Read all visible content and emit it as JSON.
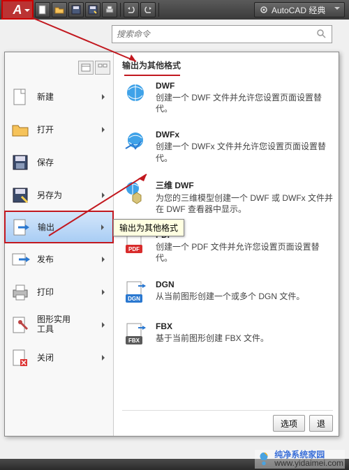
{
  "workspace": {
    "label": "AutoCAD 经典"
  },
  "search": {
    "placeholder": "搜索命令"
  },
  "left_menu": {
    "items": [
      {
        "label": "新建"
      },
      {
        "label": "打开"
      },
      {
        "label": "保存"
      },
      {
        "label": "另存为"
      },
      {
        "label": "输出"
      },
      {
        "label": "发布"
      },
      {
        "label": "打印"
      },
      {
        "label": "图形实用\n工具"
      },
      {
        "label": "关闭"
      }
    ]
  },
  "panel": {
    "title": "输出为其他格式",
    "options": [
      {
        "title": "DWF",
        "desc": "创建一个 DWF 文件并允许您设置页面设置替代。"
      },
      {
        "title": "DWFx",
        "desc": "创建一个 DWFx 文件并允许您设置页面设置替代。"
      },
      {
        "title": "三维 DWF",
        "desc": "为您的三维模型创建一个 DWF 或 DWFx 文件并在 DWF 查看器中显示。"
      },
      {
        "title": "PDF",
        "desc": "创建一个 PDF 文件并允许您设置页面设置替代。"
      },
      {
        "title": "DGN",
        "desc": "从当前图形创建一个或多个 DGN 文件。"
      },
      {
        "title": "FBX",
        "desc": "基于当前图形创建 FBX 文件。"
      }
    ]
  },
  "tooltip": "输出为其他格式",
  "footer": {
    "options": "选项",
    "exit": "退"
  },
  "watermark": {
    "line1": "纯净系统家园",
    "line2": "www.yidaimei.com"
  },
  "annotation": {
    "color": "#c2181f"
  }
}
